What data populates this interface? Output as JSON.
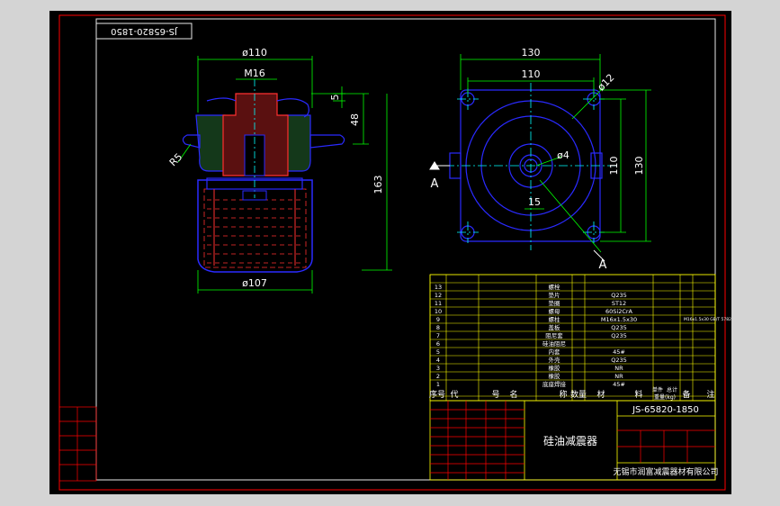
{
  "colors": {
    "viewport_bg": "#d4d4d4",
    "paper": "#000000",
    "frame": "#ff0000",
    "border": "#ffffff",
    "geometry": "#2a2aff",
    "dimension": "#00ff00",
    "center": "#00ffff",
    "table_line": "#ffff00",
    "table_text": "#ffffff",
    "hatch": "#ff3030"
  },
  "drawing_code_rotated": "JS-65820-1850",
  "front_view": {
    "dim_top_diameter": "ø110",
    "dim_thread": "M16",
    "dim_small": "5",
    "dim_48": "48",
    "dim_163": "163",
    "dim_radius": "R5",
    "dim_bottom_diameter": "ø107"
  },
  "top_view": {
    "dim_130_h": "130",
    "dim_110_h": "110",
    "dim_hole": "ø12",
    "dim_center_hole": "ø4",
    "dim_110_v": "110",
    "dim_130_v": "130",
    "dim_15": "15",
    "section_mark_left": "A",
    "section_mark_bottom": "A"
  },
  "parts_list": {
    "rows": [
      {
        "no": "13",
        "name": "螺栓",
        "material": ""
      },
      {
        "no": "12",
        "name": "垫片",
        "material": "Q235"
      },
      {
        "no": "11",
        "name": "垫圈",
        "material": "ST12"
      },
      {
        "no": "10",
        "name": "螺母",
        "material": "60Si2CrA"
      },
      {
        "no": "9",
        "name": "螺柱",
        "material": "M16x1.5x30"
      },
      {
        "no": "8",
        "name": "盖板",
        "material": "Q235"
      },
      {
        "no": "7",
        "name": "阻尼套",
        "material": "Q235"
      },
      {
        "no": "6",
        "name": "硅油阻尼",
        "material": ""
      },
      {
        "no": "5",
        "name": "内套",
        "material": "45#"
      },
      {
        "no": "4",
        "name": "外壳",
        "material": "Q235"
      },
      {
        "no": "3",
        "name": "橡胶",
        "material": "NR"
      },
      {
        "no": "2",
        "name": "橡胶",
        "material": "NR"
      },
      {
        "no": "1",
        "name": "底座焊接",
        "material": "45#"
      }
    ],
    "row9_note": "M16x1.5x30  GB/T 5782",
    "header": [
      "序号",
      "代",
      "号",
      "名",
      "称",
      "数量",
      "材",
      "料",
      "单件",
      "总计",
      "重量(kg)",
      "备",
      "注"
    ]
  },
  "title_block": {
    "drawing_code": "JS-65820-1850",
    "part_name": "硅油减震器",
    "company": "无锡市润富减震器材有限公司"
  }
}
